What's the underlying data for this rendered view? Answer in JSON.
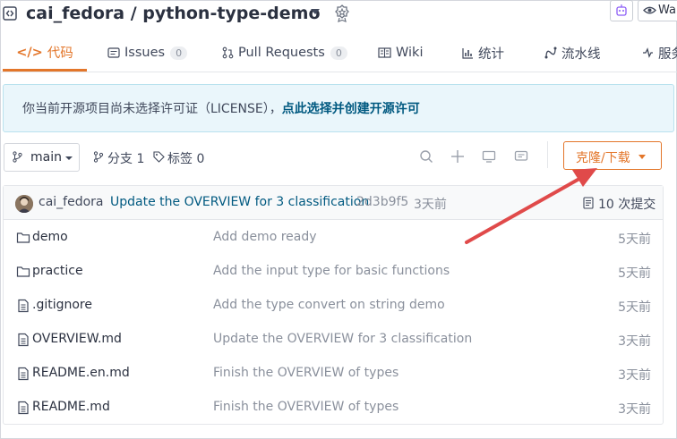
{
  "header": {
    "repo_title": "cai_fedora / python-type-demo",
    "user_partial": "Wa"
  },
  "tabs": [
    {
      "label": "代码",
      "icon": "code-icon",
      "active": true
    },
    {
      "label": "Issues",
      "count": "0",
      "icon": "issues-icon"
    },
    {
      "label": "Pull Requests",
      "count": "0",
      "icon": "pull-request-icon"
    },
    {
      "label": "Wiki",
      "icon": "wiki-icon"
    },
    {
      "label": "统计",
      "icon": "stats-icon"
    },
    {
      "label": "流水线",
      "icon": "pipeline-icon"
    },
    {
      "label": "服务",
      "icon": "service-icon"
    }
  ],
  "notice": {
    "text": "你当前开源项目尚未选择许可证（LICENSE），",
    "link": "点此选择并创建开源许可"
  },
  "branch": {
    "name": "main",
    "branches": "分支 1",
    "tags": "标签 0"
  },
  "clone_button": "克隆/下载",
  "last_commit": {
    "author": "cai_fedora",
    "message": "Update the OVERVIEW for 3 classification",
    "sha": "2d3b9f5",
    "time": "3天前",
    "count": "10 次提交"
  },
  "files": [
    {
      "name": "demo",
      "type": "folder",
      "message": "Add demo ready",
      "time": "5天前"
    },
    {
      "name": "practice",
      "type": "folder",
      "message": "Add the input type for basic functions",
      "time": "5天前"
    },
    {
      "name": ".gitignore",
      "type": "file",
      "message": "Add the type convert on string demo",
      "time": "5天前"
    },
    {
      "name": "OVERVIEW.md",
      "type": "file",
      "message": "Update the OVERVIEW for 3 classification",
      "time": "3天前"
    },
    {
      "name": "README.en.md",
      "type": "file",
      "message": "Finish the OVERVIEW of types",
      "time": "3天前"
    },
    {
      "name": "README.md",
      "type": "file",
      "message": "Finish the OVERVIEW of types",
      "time": "3天前"
    }
  ],
  "colors": {
    "accent": "#e3762a",
    "link": "#005980",
    "annotation": "#e04a4a"
  }
}
